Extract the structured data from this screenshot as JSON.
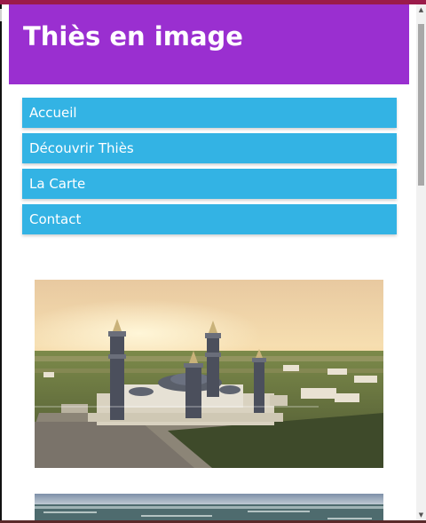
{
  "site": {
    "title": "Thiès en image",
    "header_color": "#9a2fd0"
  },
  "nav": {
    "accent_color": "#33b3e4",
    "items": [
      {
        "label": "Accueil"
      },
      {
        "label": "Découvrir Thiès"
      },
      {
        "label": "La Carte"
      },
      {
        "label": "Contact"
      }
    ]
  },
  "gallery": {
    "images": [
      {
        "subject": "Grande mosquée de Thiès au coucher du soleil, vue aérienne"
      },
      {
        "subject": "Paysage côtier, mer et horizon"
      }
    ]
  },
  "scrollbar": {
    "up_icon": "triangle-up-icon",
    "down_icon": "triangle-down-icon"
  }
}
